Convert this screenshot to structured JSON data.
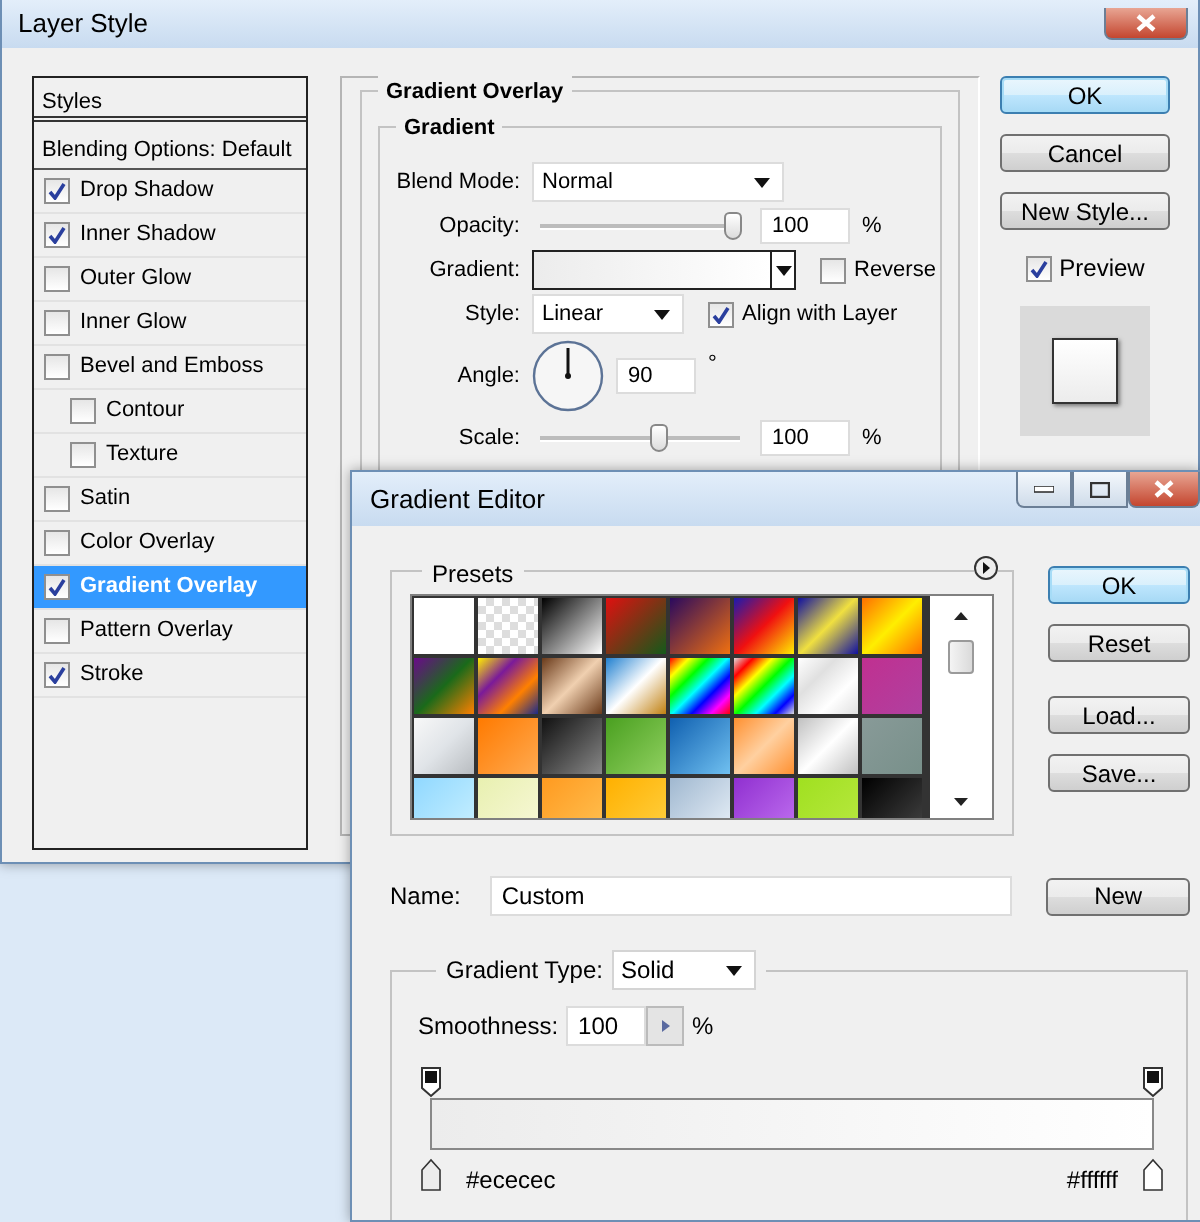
{
  "layer_style": {
    "title": "Layer Style",
    "styles_header": "Styles",
    "blending_options": "Blending Options: Default",
    "styles": [
      {
        "label": "Drop Shadow",
        "checked": true,
        "selected": false
      },
      {
        "label": "Inner Shadow",
        "checked": true,
        "selected": false
      },
      {
        "label": "Outer Glow",
        "checked": false,
        "selected": false
      },
      {
        "label": "Inner Glow",
        "checked": false,
        "selected": false
      },
      {
        "label": "Bevel and Emboss",
        "checked": false,
        "selected": false,
        "children": [
          {
            "label": "Contour",
            "checked": false,
            "selected": false
          },
          {
            "label": "Texture",
            "checked": false,
            "selected": false
          }
        ]
      },
      {
        "label": "Satin",
        "checked": false,
        "selected": false
      },
      {
        "label": "Color Overlay",
        "checked": false,
        "selected": false
      },
      {
        "label": "Gradient Overlay",
        "checked": true,
        "selected": true
      },
      {
        "label": "Pattern Overlay",
        "checked": false,
        "selected": false
      },
      {
        "label": "Stroke",
        "checked": true,
        "selected": false
      }
    ],
    "section_title": "Gradient Overlay",
    "group_title": "Gradient",
    "blend_mode": {
      "label": "Blend Mode:",
      "value": "Normal"
    },
    "opacity": {
      "label": "Opacity:",
      "level": 0.97,
      "value": "100",
      "unit": "%"
    },
    "gradient": {
      "label": "Gradient:"
    },
    "reverse": {
      "label": "Reverse",
      "checked": false
    },
    "style": {
      "label": "Style:",
      "value": "Linear"
    },
    "align": {
      "label": "Align with Layer",
      "checked": true
    },
    "angle": {
      "label": "Angle:",
      "value": "90",
      "unit": "°"
    },
    "scale": {
      "label": "Scale:",
      "level": 0.6,
      "value": "100",
      "unit": "%"
    },
    "buttons": [
      {
        "label": "OK",
        "default": true
      },
      {
        "label": "Cancel",
        "default": false
      },
      {
        "label": "New Style...",
        "default": false
      }
    ],
    "preview": {
      "label": "Preview",
      "checked": true
    }
  },
  "gradient_editor": {
    "title": "Gradient Editor",
    "presets_title": "Presets",
    "buttons": [
      {
        "label": "OK",
        "default": true
      },
      {
        "label": "Reset",
        "default": false
      },
      {
        "label": "Load...",
        "default": false
      },
      {
        "label": "Save...",
        "default": false
      }
    ],
    "name": {
      "label": "Name:",
      "value": "Custom"
    },
    "new_button": "New",
    "gradient_type": {
      "label": "Gradient Type:",
      "value": "Solid"
    },
    "smoothness": {
      "label": "Smoothness:",
      "value": "100",
      "unit": "%"
    },
    "stops": [
      {
        "label": "#ececec",
        "color": "#ececec"
      },
      {
        "label": "#ffffff",
        "color": "#ffffff"
      }
    ]
  }
}
